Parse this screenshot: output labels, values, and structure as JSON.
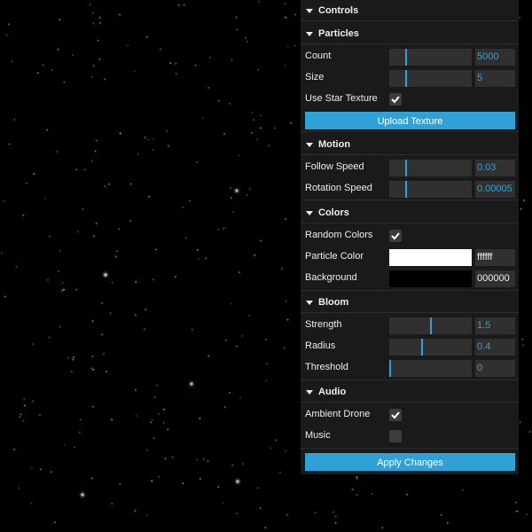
{
  "scene": {
    "background": "#000000"
  },
  "panel": {
    "title": "Controls",
    "accent": "#2fa1d6",
    "sections": {
      "particles": {
        "title": "Particles",
        "count": {
          "label": "Count",
          "value": "5000",
          "level": 0.2
        },
        "size": {
          "label": "Size",
          "value": "5",
          "level": 0.2
        },
        "use_star_texture": {
          "label": "Use Star Texture",
          "checked": true
        },
        "upload_button": "Upload Texture"
      },
      "motion": {
        "title": "Motion",
        "follow_speed": {
          "label": "Follow Speed",
          "value": "0.03",
          "level": 0.2
        },
        "rotation_speed": {
          "label": "Rotation Speed",
          "value": "0.00005",
          "level": 0.2
        }
      },
      "colors": {
        "title": "Colors",
        "random_colors": {
          "label": "Random Colors",
          "checked": true
        },
        "particle_color": {
          "label": "Particle Color",
          "value": "ffffff",
          "swatch": "#ffffff"
        },
        "background": {
          "label": "Background",
          "value": "000000",
          "swatch": "#000000"
        }
      },
      "bloom": {
        "title": "Bloom",
        "strength": {
          "label": "Strength",
          "value": "1.5",
          "level": 0.5
        },
        "radius": {
          "label": "Radius",
          "value": "0.4",
          "level": 0.4
        },
        "threshold": {
          "label": "Threshold",
          "value": "0",
          "level": 0.0
        }
      },
      "audio": {
        "title": "Audio",
        "ambient_drone": {
          "label": "Ambient Drone",
          "checked": true
        },
        "music": {
          "label": "Music",
          "checked": false
        }
      }
    },
    "apply_button": "Apply Changes"
  }
}
